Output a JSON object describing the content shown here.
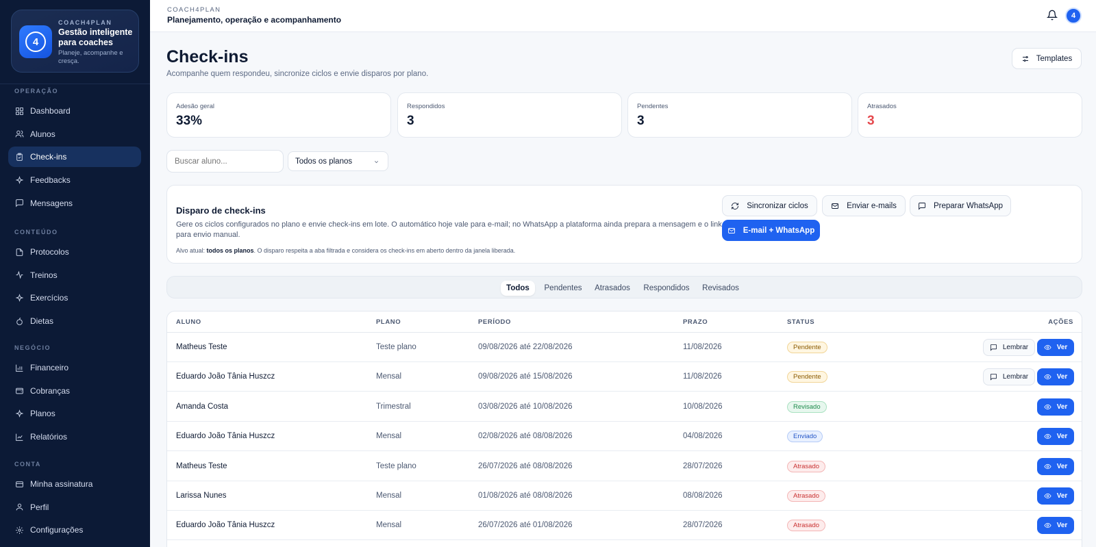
{
  "brand": {
    "small": "COACH4PLAN",
    "title": "Gestão inteligente para coaches",
    "subtitle": "Planeje, acompanhe e cresça.",
    "logo_text": "4"
  },
  "sidebar": {
    "sections": [
      {
        "label": "OPERAÇÃO",
        "items": [
          {
            "label": "Dashboard",
            "icon": "grid-icon",
            "active": false
          },
          {
            "label": "Alunos",
            "icon": "users-icon",
            "active": false
          },
          {
            "label": "Check-ins",
            "icon": "clipboard-check-icon",
            "active": true
          },
          {
            "label": "Feedbacks",
            "icon": "sparkle-icon",
            "active": false
          },
          {
            "label": "Mensagens",
            "icon": "message-icon",
            "active": false
          }
        ]
      },
      {
        "label": "CONTEÚDO",
        "items": [
          {
            "label": "Protocolos",
            "icon": "document-icon",
            "active": false
          },
          {
            "label": "Treinos",
            "icon": "activity-icon",
            "active": false
          },
          {
            "label": "Exercícios",
            "icon": "sparkle-icon",
            "active": false
          },
          {
            "label": "Dietas",
            "icon": "apple-icon",
            "active": false
          }
        ]
      },
      {
        "label": "NEGÓCIO",
        "items": [
          {
            "label": "Financeiro",
            "icon": "bar-chart-icon",
            "active": false
          },
          {
            "label": "Cobranças",
            "icon": "wallet-icon",
            "active": false
          },
          {
            "label": "Planos",
            "icon": "sparkle-icon",
            "active": false
          },
          {
            "label": "Relatórios",
            "icon": "line-chart-icon",
            "active": false
          }
        ]
      },
      {
        "label": "CONTA",
        "items": [
          {
            "label": "Minha assinatura",
            "icon": "card-icon",
            "active": false
          },
          {
            "label": "Perfil",
            "icon": "user-icon",
            "active": false
          },
          {
            "label": "Configurações",
            "icon": "gear-icon",
            "active": false
          }
        ]
      }
    ]
  },
  "topbar": {
    "small": "COACH4PLAN",
    "title": "Planejamento, operação e acompanhamento",
    "avatar": "4"
  },
  "page": {
    "title": "Check-ins",
    "subtitle": "Acompanhe quem respondeu, sincronize ciclos e envie disparos por plano.",
    "templates_label": "Templates"
  },
  "stats": [
    {
      "label": "Adesão geral",
      "value": "33%",
      "color": "#0f1b33"
    },
    {
      "label": "Respondidos",
      "value": "3",
      "color": "#0f1b33"
    },
    {
      "label": "Pendentes",
      "value": "3",
      "color": "#0f1b33"
    },
    {
      "label": "Atrasados",
      "value": "3",
      "color": "#e5484d"
    }
  ],
  "filters": {
    "search_placeholder": "Buscar aluno...",
    "plan_select": "Todos os planos"
  },
  "disparo": {
    "title": "Disparo de check-ins",
    "description": "Gere os ciclos configurados no plano e envie check-ins em lote. O automático hoje vale para e-mail; no WhatsApp a plataforma ainda prepara a mensagem e o link para envio manual.",
    "target_prefix": "Alvo atual: ",
    "target_value": "todos os planos",
    "target_suffix": ". O disparo respeita a aba filtrada e considera os check-ins em aberto dentro da janela liberada.",
    "buttons": {
      "sync": "Sincronizar ciclos",
      "email": "Enviar e-mails",
      "whatsapp": "Preparar WhatsApp",
      "both": "E-mail + WhatsApp"
    }
  },
  "tabs": [
    "Todos",
    "Pendentes",
    "Atrasados",
    "Respondidos",
    "Revisados"
  ],
  "table": {
    "headers": {
      "aluno": "ALUNO",
      "plano": "PLANO",
      "periodo": "PERÍODO",
      "prazo": "PRAZO",
      "status": "STATUS",
      "acoes": "AÇÕES"
    },
    "lembrar_label": "Lembrar",
    "ver_label": "Ver",
    "rows": [
      {
        "aluno": "Matheus Teste",
        "plano": "Teste plano",
        "periodo": "09/08/2026 até 22/08/2026",
        "prazo": "11/08/2026",
        "status": "Pendente",
        "status_key": "pendente",
        "lembrar": true
      },
      {
        "aluno": "Eduardo João Tânia Huszcz",
        "plano": "Mensal",
        "periodo": "09/08/2026 até 15/08/2026",
        "prazo": "11/08/2026",
        "status": "Pendente",
        "status_key": "pendente",
        "lembrar": true
      },
      {
        "aluno": "Amanda Costa",
        "plano": "Trimestral",
        "periodo": "03/08/2026 até 10/08/2026",
        "prazo": "10/08/2026",
        "status": "Revisado",
        "status_key": "revisado",
        "lembrar": false
      },
      {
        "aluno": "Eduardo João Tânia Huszcz",
        "plano": "Mensal",
        "periodo": "02/08/2026 até 08/08/2026",
        "prazo": "04/08/2026",
        "status": "Enviado",
        "status_key": "enviado",
        "lembrar": false
      },
      {
        "aluno": "Matheus Teste",
        "plano": "Teste plano",
        "periodo": "26/07/2026 até 08/08/2026",
        "prazo": "28/07/2026",
        "status": "Atrasado",
        "status_key": "atrasado",
        "lembrar": false
      },
      {
        "aluno": "Larissa Nunes",
        "plano": "Mensal",
        "periodo": "01/08/2026 até 08/08/2026",
        "prazo": "08/08/2026",
        "status": "Atrasado",
        "status_key": "atrasado",
        "lembrar": false
      },
      {
        "aluno": "Eduardo João Tânia Huszcz",
        "plano": "Mensal",
        "periodo": "26/07/2026 até 01/08/2026",
        "prazo": "28/07/2026",
        "status": "Atrasado",
        "status_key": "atrasado",
        "lembrar": false
      }
    ]
  }
}
